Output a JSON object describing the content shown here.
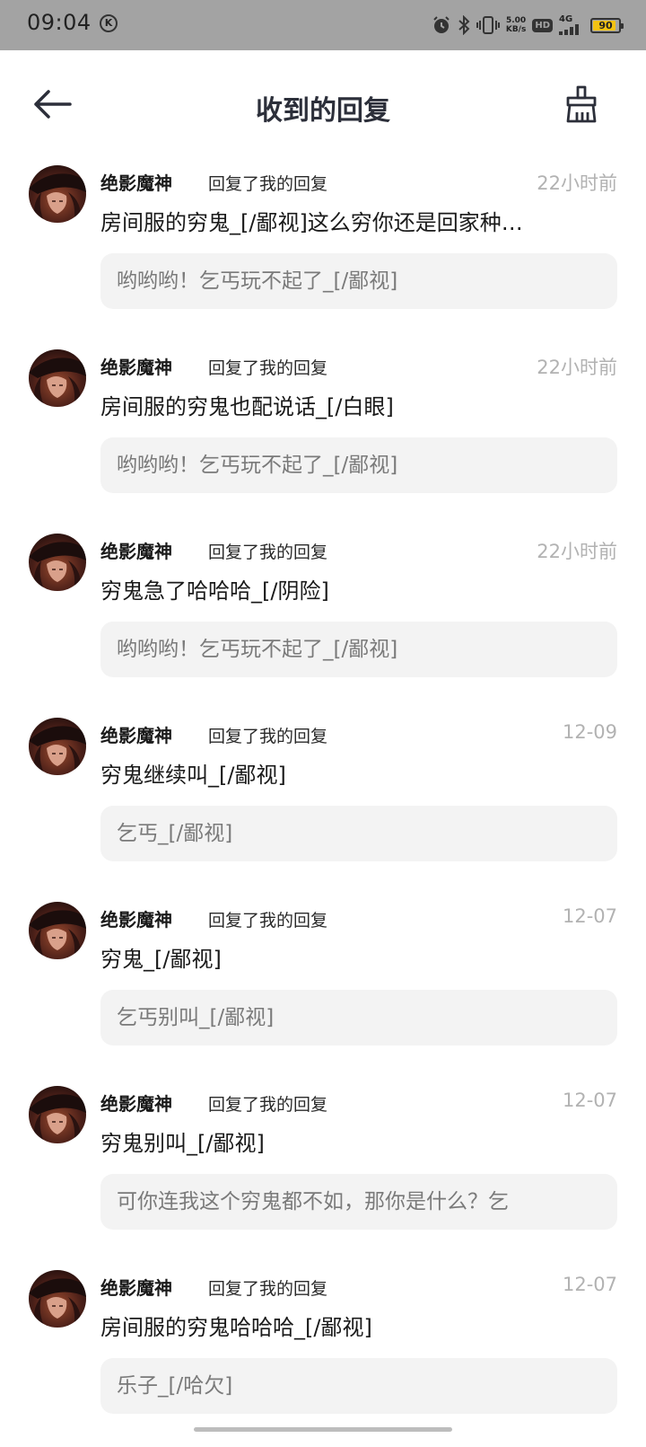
{
  "status_bar": {
    "time": "09:04",
    "k_badge": "K",
    "net_speed_value": "5.00",
    "net_speed_unit": "KB/s",
    "hd_label": "HD",
    "signal_label": "4G",
    "battery_level": "90",
    "battery_color": "#f3c313"
  },
  "header": {
    "title": "收到的回复",
    "back_icon": "arrow-left-icon",
    "clean_icon": "broom-icon"
  },
  "replies": [
    {
      "name": "绝影魔神",
      "action": "回复了我的回复",
      "time": "22小时前",
      "text": "房间服的穷鬼_[/鄙视]这么穷你还是回家种…",
      "quote": "哟哟哟！乞丐玩不起了_[/鄙视]"
    },
    {
      "name": "绝影魔神",
      "action": "回复了我的回复",
      "time": "22小时前",
      "text": "房间服的穷鬼也配说话_[/白眼]",
      "quote": "哟哟哟！乞丐玩不起了_[/鄙视]"
    },
    {
      "name": "绝影魔神",
      "action": "回复了我的回复",
      "time": "22小时前",
      "text": "穷鬼急了哈哈哈_[/阴险]",
      "quote": "哟哟哟！乞丐玩不起了_[/鄙视]"
    },
    {
      "name": "绝影魔神",
      "action": "回复了我的回复",
      "time": "12-09",
      "text": "穷鬼继续叫_[/鄙视]",
      "quote": "乞丐_[/鄙视]"
    },
    {
      "name": "绝影魔神",
      "action": "回复了我的回复",
      "time": "12-07",
      "text": "穷鬼_[/鄙视]",
      "quote": "乞丐别叫_[/鄙视]"
    },
    {
      "name": "绝影魔神",
      "action": "回复了我的回复",
      "time": "12-07",
      "text": "穷鬼别叫_[/鄙视]",
      "quote": "可你连我这个穷鬼都不如，那你是什么？乞"
    },
    {
      "name": "绝影魔神",
      "action": "回复了我的回复",
      "time": "12-07",
      "text": "房间服的穷鬼哈哈哈_[/鄙视]",
      "quote": "乐子_[/哈欠]"
    }
  ]
}
